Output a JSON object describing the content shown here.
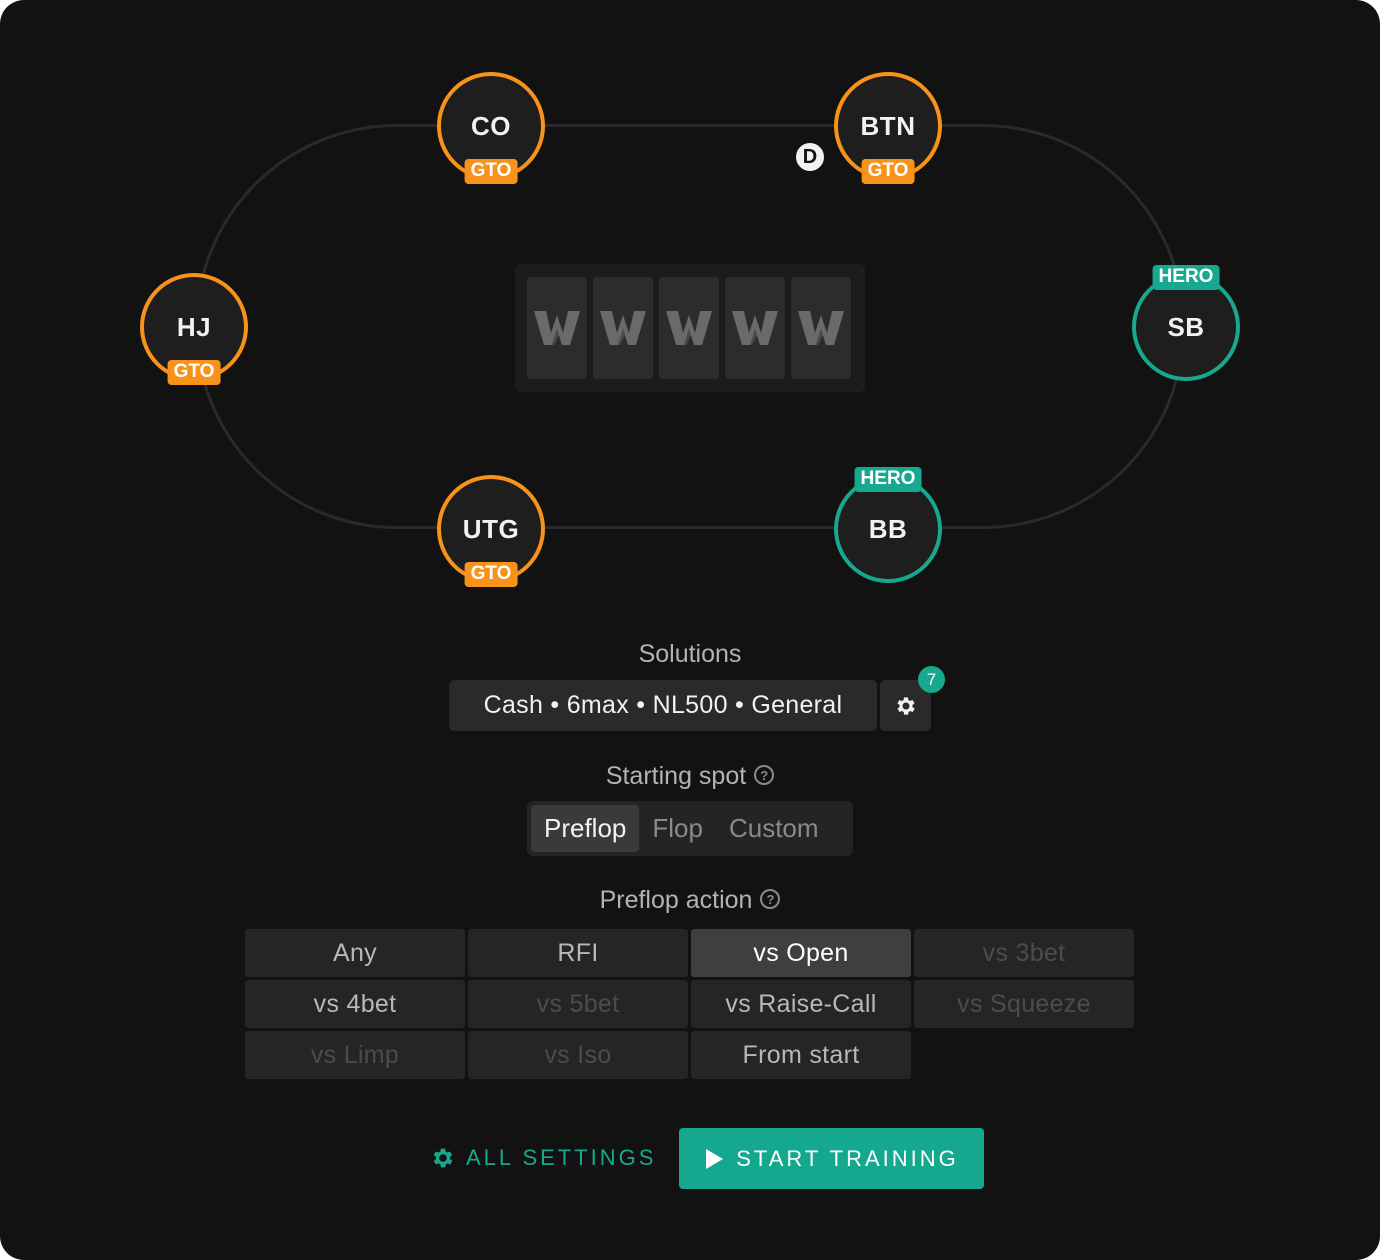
{
  "seats": {
    "co": {
      "label": "CO",
      "badge": "GTO"
    },
    "btn": {
      "label": "BTN",
      "badge": "GTO"
    },
    "hj": {
      "label": "HJ",
      "badge": "GTO"
    },
    "sb": {
      "label": "SB",
      "badge": "HERO"
    },
    "utg": {
      "label": "UTG",
      "badge": "GTO"
    },
    "bb": {
      "label": "BB",
      "badge": "HERO"
    }
  },
  "dealer_button": "D",
  "board": {
    "card_count": 5,
    "card_icon": "w-logo-icon"
  },
  "solutions": {
    "label": "Solutions",
    "value": "Cash • 6max • NL500 • General",
    "settings_count": "7"
  },
  "starting_spot": {
    "label": "Starting spot",
    "help": "?",
    "options": [
      "Preflop",
      "Flop",
      "Custom"
    ],
    "selected": "Preflop"
  },
  "preflop_action": {
    "label": "Preflop action",
    "help": "?",
    "options": [
      {
        "label": "Any",
        "state": "normal"
      },
      {
        "label": "RFI",
        "state": "normal"
      },
      {
        "label": "vs Open",
        "state": "active"
      },
      {
        "label": "vs 3bet",
        "state": "disabled"
      },
      {
        "label": "vs 4bet",
        "state": "normal"
      },
      {
        "label": "vs 5bet",
        "state": "disabled"
      },
      {
        "label": "vs Raise-Call",
        "state": "normal"
      },
      {
        "label": "vs Squeeze",
        "state": "disabled"
      },
      {
        "label": "vs Limp",
        "state": "disabled"
      },
      {
        "label": "vs Iso",
        "state": "disabled"
      },
      {
        "label": "From start",
        "state": "normal"
      }
    ]
  },
  "footer": {
    "all_settings": "ALL SETTINGS",
    "start_training": "START TRAINING"
  },
  "colors": {
    "accent": "#17a88f",
    "gto_orange": "#f7931a",
    "background": "#121212"
  }
}
